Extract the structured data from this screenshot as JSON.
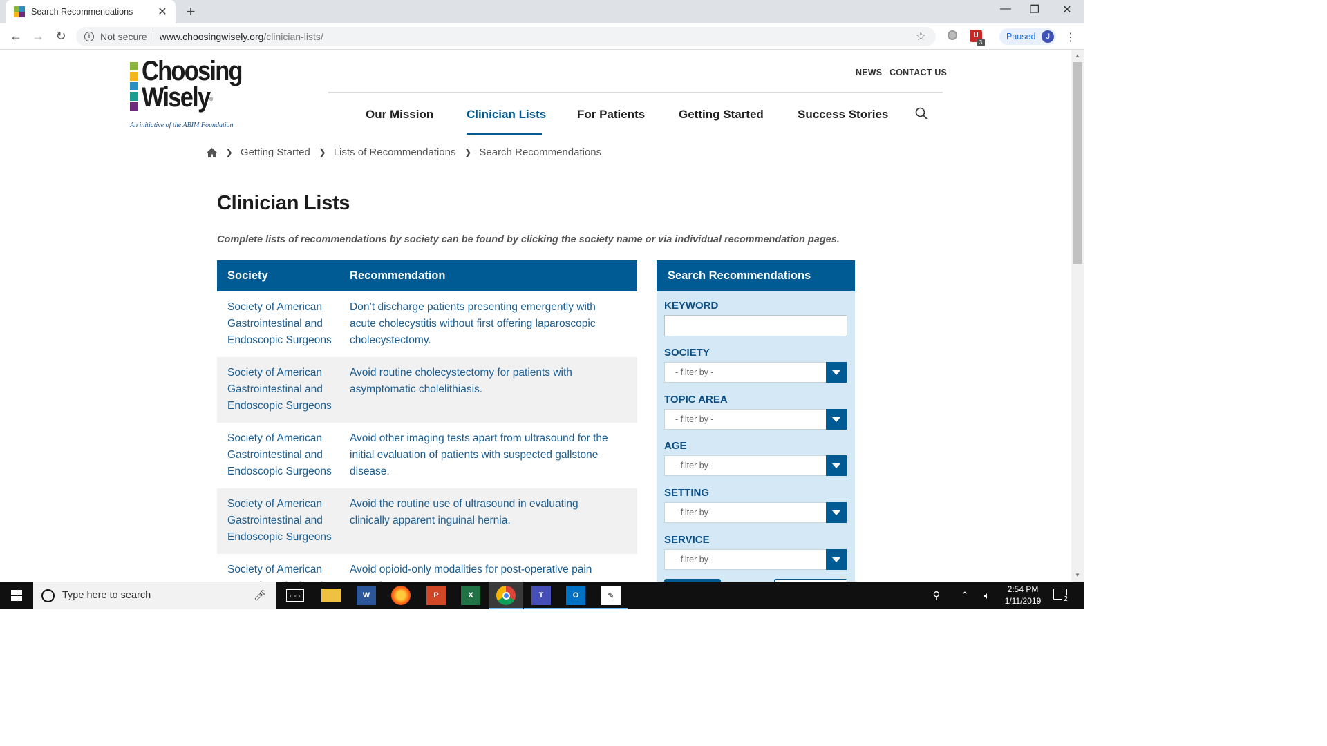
{
  "browser": {
    "tab_title": "Search Recommendations",
    "tab_close": "✕",
    "new_tab": "+",
    "window_controls": {
      "minimize": "—",
      "restore": "❐",
      "close": "✕"
    },
    "security_label": "Not secure",
    "url_host": "www.choosingwisely.org",
    "url_path": "/clinician-lists/",
    "extension_badge": "3",
    "profile_status": "Paused",
    "profile_initial": "J"
  },
  "site": {
    "logo_line1": "Choosing",
    "logo_line2": "Wisely",
    "logo_reg": "®",
    "logo_tagline": "An initiative of the ABIM Foundation",
    "logo_colors": [
      "#8cb53f",
      "#f2b81b",
      "#2a8fc1",
      "#1a9c8f",
      "#6c2c7a"
    ],
    "utility_nav": {
      "news": "NEWS",
      "contact": "CONTACT US"
    },
    "main_nav": [
      {
        "label": "Our Mission"
      },
      {
        "label": "Clinician Lists"
      },
      {
        "label": "For Patients"
      },
      {
        "label": "Getting Started"
      },
      {
        "label": "Success Stories"
      }
    ],
    "accent_color": "#005b94"
  },
  "breadcrumb": {
    "items": [
      "Getting Started",
      "Lists of Recommendations",
      "Search Recommendations"
    ]
  },
  "page": {
    "title": "Clinician Lists",
    "intro": "Complete lists of recommendations by society can be found by clicking the society name or via individual recommendation pages."
  },
  "table": {
    "headers": {
      "society": "Society",
      "recommendation": "Recommendation"
    },
    "rows": [
      {
        "society": "Society of American Gastrointestinal and Endoscopic Surgeons",
        "recommendation": "Don’t discharge patients presenting emergently with acute cholecystitis without first offering laparoscopic cholecystectomy."
      },
      {
        "society": "Society of American Gastrointestinal and Endoscopic Surgeons",
        "recommendation": "Avoid routine cholecystectomy for patients with asymptomatic cholelithiasis."
      },
      {
        "society": "Society of American Gastrointestinal and Endoscopic Surgeons",
        "recommendation": "Avoid other imaging tests apart from ultrasound for the initial evaluation of patients with suspected gallstone disease."
      },
      {
        "society": "Society of American Gastrointestinal and Endoscopic Surgeons",
        "recommendation": "Avoid the routine use of ultrasound in evaluating clinically apparent inguinal hernia."
      },
      {
        "society": "Society of American Gastrointestinal and",
        "recommendation": "Avoid opioid-only modalities for post-operative pain control."
      }
    ]
  },
  "sidebar": {
    "title": "Search Recommendations",
    "keyword_label": "KEYWORD",
    "keyword_value": "",
    "filters": [
      {
        "label": "SOCIETY",
        "value": "- filter by -"
      },
      {
        "label": "TOPIC AREA",
        "value": "- filter by -"
      },
      {
        "label": "AGE",
        "value": "- filter by -"
      },
      {
        "label": "SETTING",
        "value": "- filter by -"
      },
      {
        "label": "SERVICE",
        "value": "- filter by -"
      }
    ]
  },
  "taskbar": {
    "search_placeholder": "Type here to search",
    "apps": [
      "Task View",
      "File Explorer",
      "Word",
      "Firefox",
      "PowerPoint",
      "Excel",
      "Chrome",
      "Teams",
      "Outlook",
      "Sticky Notes"
    ],
    "time": "2:54 PM",
    "date": "1/11/2019",
    "notification_count": "2"
  }
}
